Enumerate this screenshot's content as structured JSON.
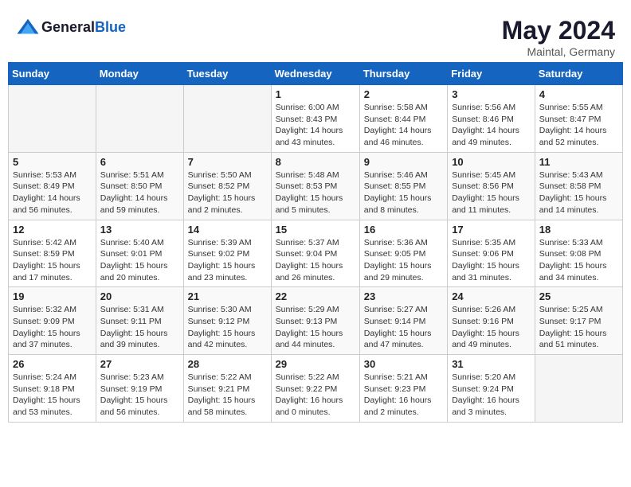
{
  "header": {
    "logo_general": "General",
    "logo_blue": "Blue",
    "month_year": "May 2024",
    "location": "Maintal, Germany"
  },
  "days_of_week": [
    "Sunday",
    "Monday",
    "Tuesday",
    "Wednesday",
    "Thursday",
    "Friday",
    "Saturday"
  ],
  "weeks": [
    [
      {
        "day": "",
        "info": ""
      },
      {
        "day": "",
        "info": ""
      },
      {
        "day": "",
        "info": ""
      },
      {
        "day": "1",
        "info": "Sunrise: 6:00 AM\nSunset: 8:43 PM\nDaylight: 14 hours\nand 43 minutes."
      },
      {
        "day": "2",
        "info": "Sunrise: 5:58 AM\nSunset: 8:44 PM\nDaylight: 14 hours\nand 46 minutes."
      },
      {
        "day": "3",
        "info": "Sunrise: 5:56 AM\nSunset: 8:46 PM\nDaylight: 14 hours\nand 49 minutes."
      },
      {
        "day": "4",
        "info": "Sunrise: 5:55 AM\nSunset: 8:47 PM\nDaylight: 14 hours\nand 52 minutes."
      }
    ],
    [
      {
        "day": "5",
        "info": "Sunrise: 5:53 AM\nSunset: 8:49 PM\nDaylight: 14 hours\nand 56 minutes."
      },
      {
        "day": "6",
        "info": "Sunrise: 5:51 AM\nSunset: 8:50 PM\nDaylight: 14 hours\nand 59 minutes."
      },
      {
        "day": "7",
        "info": "Sunrise: 5:50 AM\nSunset: 8:52 PM\nDaylight: 15 hours\nand 2 minutes."
      },
      {
        "day": "8",
        "info": "Sunrise: 5:48 AM\nSunset: 8:53 PM\nDaylight: 15 hours\nand 5 minutes."
      },
      {
        "day": "9",
        "info": "Sunrise: 5:46 AM\nSunset: 8:55 PM\nDaylight: 15 hours\nand 8 minutes."
      },
      {
        "day": "10",
        "info": "Sunrise: 5:45 AM\nSunset: 8:56 PM\nDaylight: 15 hours\nand 11 minutes."
      },
      {
        "day": "11",
        "info": "Sunrise: 5:43 AM\nSunset: 8:58 PM\nDaylight: 15 hours\nand 14 minutes."
      }
    ],
    [
      {
        "day": "12",
        "info": "Sunrise: 5:42 AM\nSunset: 8:59 PM\nDaylight: 15 hours\nand 17 minutes."
      },
      {
        "day": "13",
        "info": "Sunrise: 5:40 AM\nSunset: 9:01 PM\nDaylight: 15 hours\nand 20 minutes."
      },
      {
        "day": "14",
        "info": "Sunrise: 5:39 AM\nSunset: 9:02 PM\nDaylight: 15 hours\nand 23 minutes."
      },
      {
        "day": "15",
        "info": "Sunrise: 5:37 AM\nSunset: 9:04 PM\nDaylight: 15 hours\nand 26 minutes."
      },
      {
        "day": "16",
        "info": "Sunrise: 5:36 AM\nSunset: 9:05 PM\nDaylight: 15 hours\nand 29 minutes."
      },
      {
        "day": "17",
        "info": "Sunrise: 5:35 AM\nSunset: 9:06 PM\nDaylight: 15 hours\nand 31 minutes."
      },
      {
        "day": "18",
        "info": "Sunrise: 5:33 AM\nSunset: 9:08 PM\nDaylight: 15 hours\nand 34 minutes."
      }
    ],
    [
      {
        "day": "19",
        "info": "Sunrise: 5:32 AM\nSunset: 9:09 PM\nDaylight: 15 hours\nand 37 minutes."
      },
      {
        "day": "20",
        "info": "Sunrise: 5:31 AM\nSunset: 9:11 PM\nDaylight: 15 hours\nand 39 minutes."
      },
      {
        "day": "21",
        "info": "Sunrise: 5:30 AM\nSunset: 9:12 PM\nDaylight: 15 hours\nand 42 minutes."
      },
      {
        "day": "22",
        "info": "Sunrise: 5:29 AM\nSunset: 9:13 PM\nDaylight: 15 hours\nand 44 minutes."
      },
      {
        "day": "23",
        "info": "Sunrise: 5:27 AM\nSunset: 9:14 PM\nDaylight: 15 hours\nand 47 minutes."
      },
      {
        "day": "24",
        "info": "Sunrise: 5:26 AM\nSunset: 9:16 PM\nDaylight: 15 hours\nand 49 minutes."
      },
      {
        "day": "25",
        "info": "Sunrise: 5:25 AM\nSunset: 9:17 PM\nDaylight: 15 hours\nand 51 minutes."
      }
    ],
    [
      {
        "day": "26",
        "info": "Sunrise: 5:24 AM\nSunset: 9:18 PM\nDaylight: 15 hours\nand 53 minutes."
      },
      {
        "day": "27",
        "info": "Sunrise: 5:23 AM\nSunset: 9:19 PM\nDaylight: 15 hours\nand 56 minutes."
      },
      {
        "day": "28",
        "info": "Sunrise: 5:22 AM\nSunset: 9:21 PM\nDaylight: 15 hours\nand 58 minutes."
      },
      {
        "day": "29",
        "info": "Sunrise: 5:22 AM\nSunset: 9:22 PM\nDaylight: 16 hours\nand 0 minutes."
      },
      {
        "day": "30",
        "info": "Sunrise: 5:21 AM\nSunset: 9:23 PM\nDaylight: 16 hours\nand 2 minutes."
      },
      {
        "day": "31",
        "info": "Sunrise: 5:20 AM\nSunset: 9:24 PM\nDaylight: 16 hours\nand 3 minutes."
      },
      {
        "day": "",
        "info": ""
      }
    ]
  ]
}
